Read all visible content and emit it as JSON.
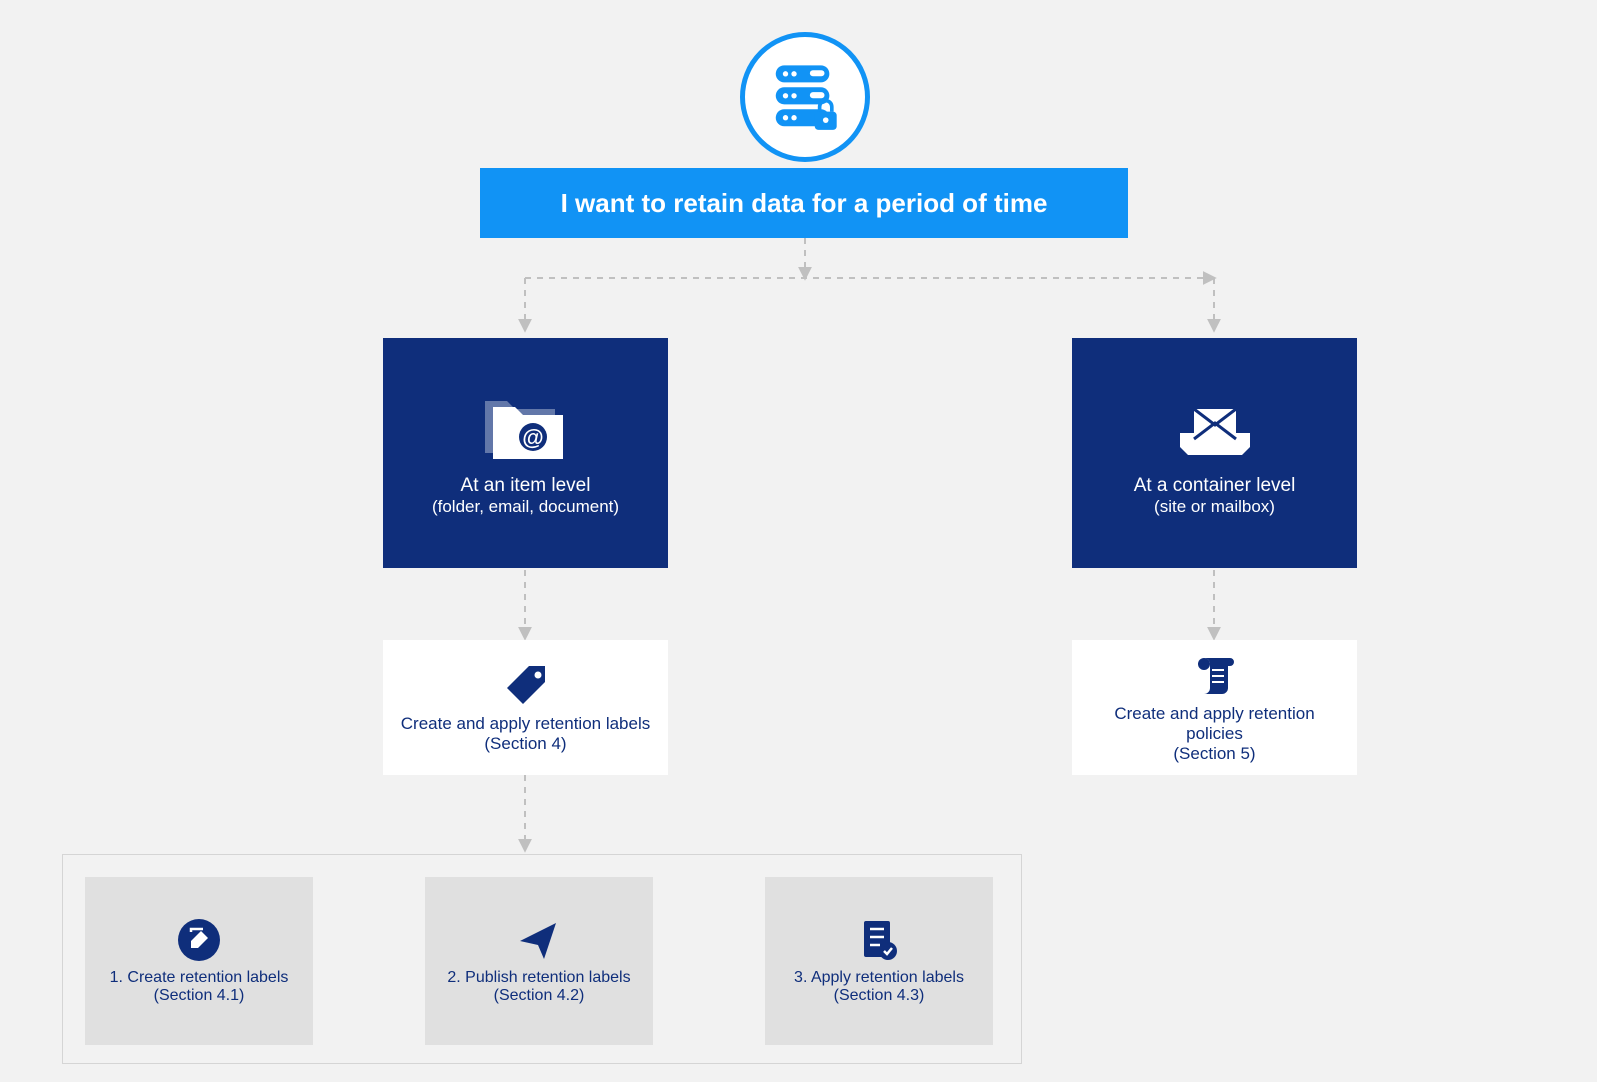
{
  "hero": {
    "title": "I want to retain data for a period of time"
  },
  "levels": {
    "item": {
      "title": "At an item level",
      "sub": "(folder, email, document)"
    },
    "container": {
      "title": "At a container level",
      "sub": "(site or mailbox)"
    }
  },
  "actions": {
    "labels": {
      "title": "Create and apply retention labels",
      "sub": "(Section 4)"
    },
    "policies": {
      "title": "Create and apply retention policies",
      "sub": "(Section 5)"
    }
  },
  "steps": {
    "s1": {
      "title": "1. Create retention labels",
      "sub": "(Section 4.1)"
    },
    "s2": {
      "title": "2. Publish retention labels",
      "sub": "(Section 4.2)"
    },
    "s3": {
      "title": "3. Apply retention labels",
      "sub": "(Section 4.3)"
    }
  }
}
